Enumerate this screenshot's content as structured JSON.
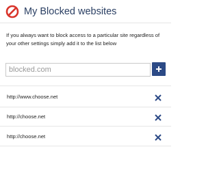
{
  "header": {
    "icon": "blocked-icon",
    "title": "My Blocked websites"
  },
  "description": {
    "line1": "If you always want to block access to a particular site regardless of",
    "line2": "your other settings simply add it to the list below"
  },
  "add_site": {
    "placeholder": "blocked.com",
    "value": "",
    "button_icon": "plus-icon"
  },
  "blocked_sites": [
    {
      "url": "http://www.choose.net",
      "remove_icon": "close-icon"
    },
    {
      "url": "http://choose.net",
      "remove_icon": "close-icon"
    },
    {
      "url": "http://choose.net",
      "remove_icon": "close-icon"
    }
  ],
  "colors": {
    "accent": "#2c4a86",
    "title": "#2a3f63",
    "block_icon": "#d9342b",
    "divider": "#e6e6e6"
  }
}
